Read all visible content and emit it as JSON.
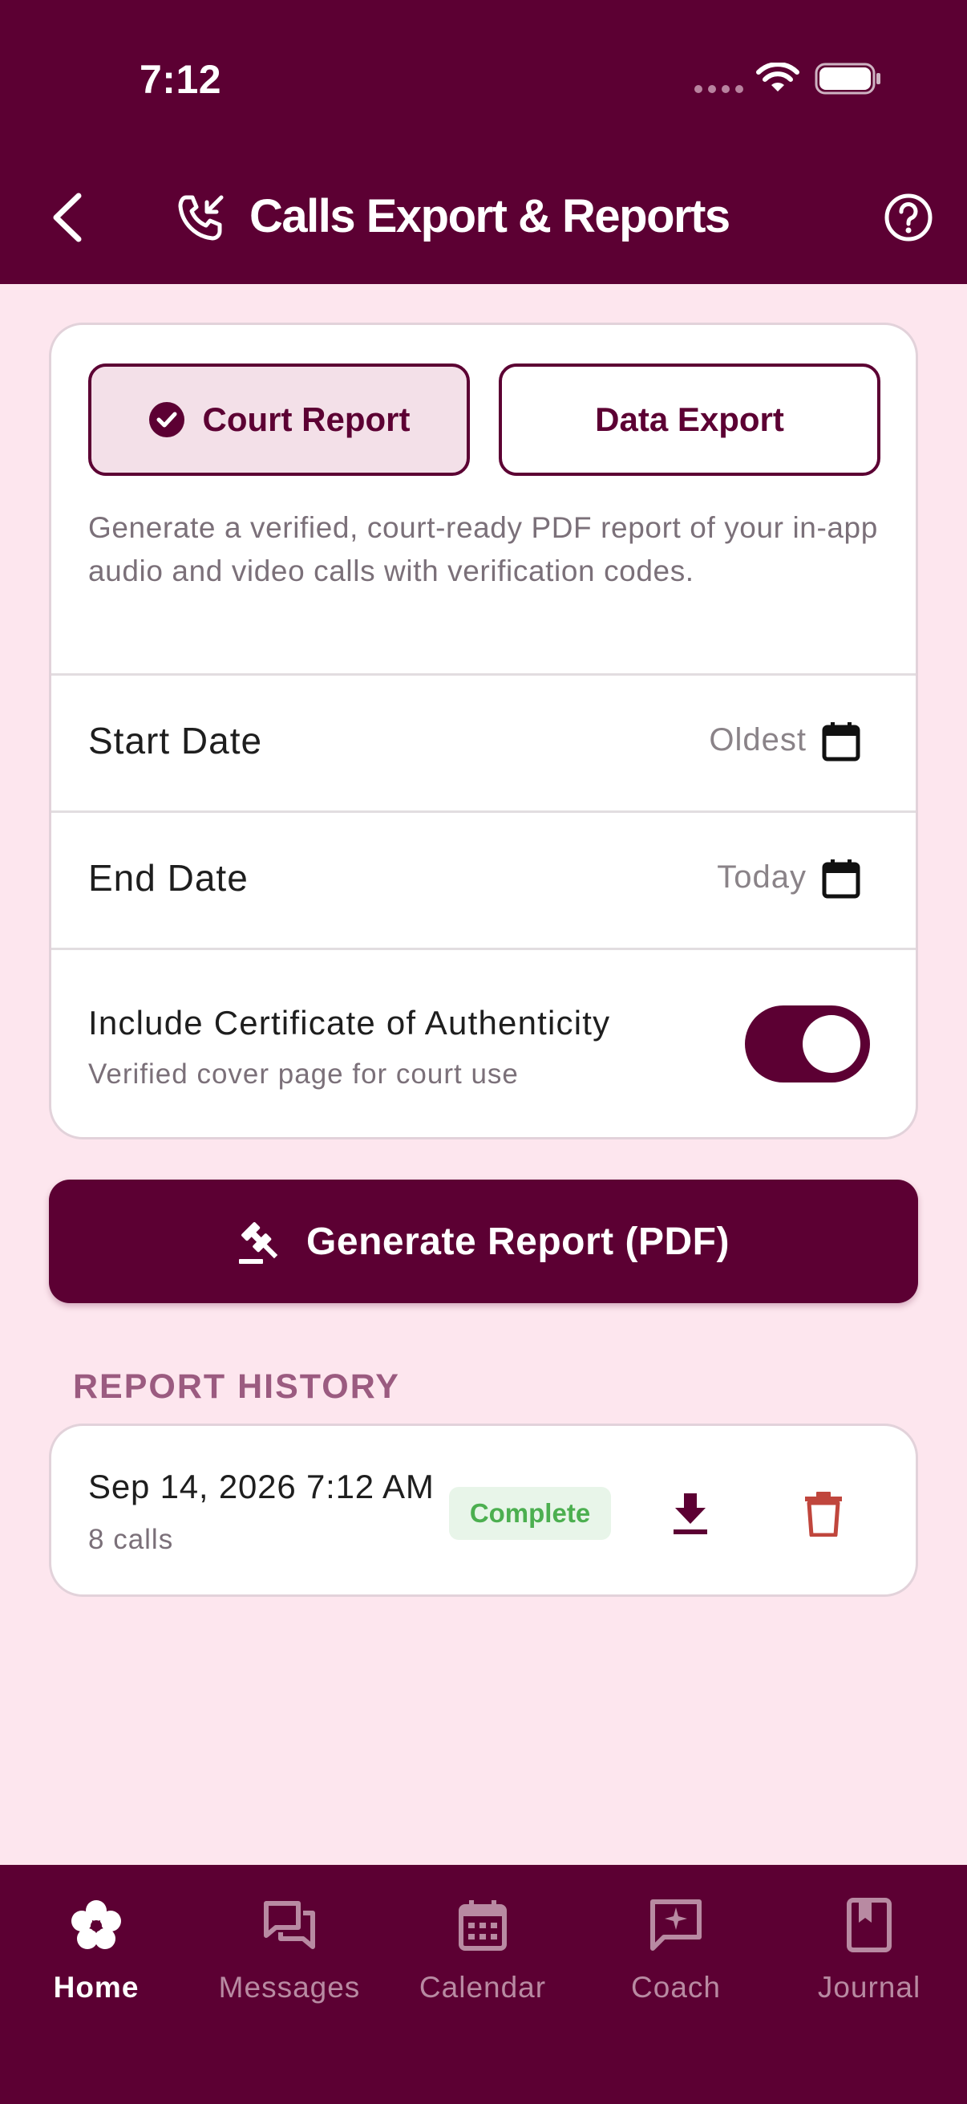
{
  "status_bar": {
    "time": "7:12"
  },
  "header": {
    "title": "Calls Export & Reports"
  },
  "segments": {
    "court": "Court Report",
    "data": "Data Export"
  },
  "description": "Generate a verified, court-ready PDF report of your in-app audio and video calls with verification codes.",
  "start_date": {
    "label": "Start Date",
    "value": "Oldest"
  },
  "end_date": {
    "label": "End Date",
    "value": "Today"
  },
  "certificate": {
    "title": "Include Certificate of Authenticity",
    "subtitle": "Verified cover page for court use",
    "enabled": true
  },
  "generate_button": "Generate Report (PDF)",
  "history": {
    "title": "REPORT HISTORY",
    "items": [
      {
        "date": "Sep 14, 2026 7:12 AM",
        "count": "8 calls",
        "status": "Complete"
      }
    ]
  },
  "nav": [
    {
      "label": "Home",
      "icon": "flower-icon",
      "active": true
    },
    {
      "label": "Messages",
      "icon": "chat-icon"
    },
    {
      "label": "Calendar",
      "icon": "calendar-icon"
    },
    {
      "label": "Coach",
      "icon": "sparkle-chat-icon"
    },
    {
      "label": "Journal",
      "icon": "journal-icon"
    }
  ],
  "colors": {
    "primary": "#5c0033",
    "background": "#fde6ee",
    "success": "#4caf50",
    "danger": "#c0463d"
  }
}
